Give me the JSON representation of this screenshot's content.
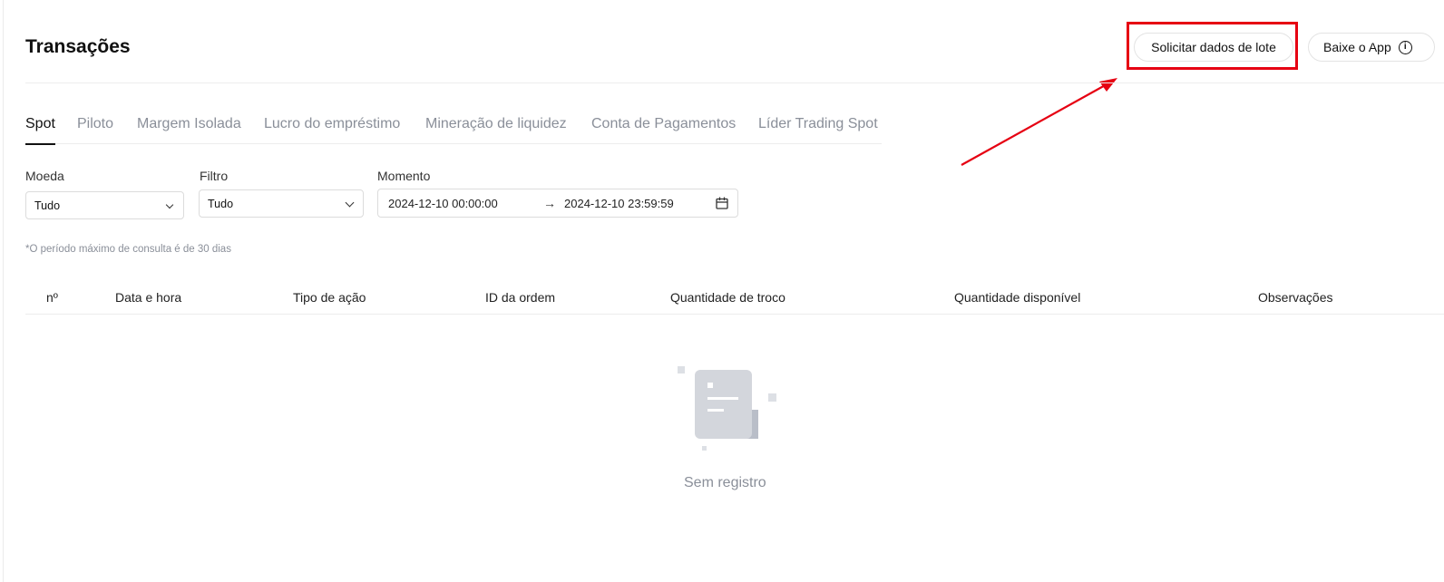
{
  "page": {
    "title": "Transações"
  },
  "header": {
    "batch_button": "Solicitar dados de lote",
    "app_button": "Baixe o App",
    "annotation_color": "#e60012"
  },
  "tabs": [
    "Spot",
    "Piloto",
    "Margem Isolada",
    "Lucro do empréstimo",
    "Mineração de liquidez",
    "Conta de Pagamentos",
    "Líder Trading Spot"
  ],
  "active_tab": "Spot",
  "filters": {
    "currency_label": "Moeda",
    "currency_value": "Tudo",
    "filter_label": "Filtro",
    "filter_value": "Tudo",
    "time_label": "Momento",
    "start": "2024-12-10 00:00:00",
    "separator": "→",
    "end": "2024-12-10 23:59:59"
  },
  "hint": "*O período máximo de consulta é de 30 dias",
  "table": {
    "columns": [
      "nº",
      "Data e hora",
      "Tipo de ação",
      "ID da ordem",
      "Quantidade de troco",
      "Quantidade disponível",
      "Observações"
    ]
  },
  "empty": {
    "text": "Sem registro",
    "icon": "empty-document-icon"
  },
  "icons": {
    "info": "info-icon",
    "chevron": "chevron-down-icon",
    "calendar": "calendar-icon"
  }
}
